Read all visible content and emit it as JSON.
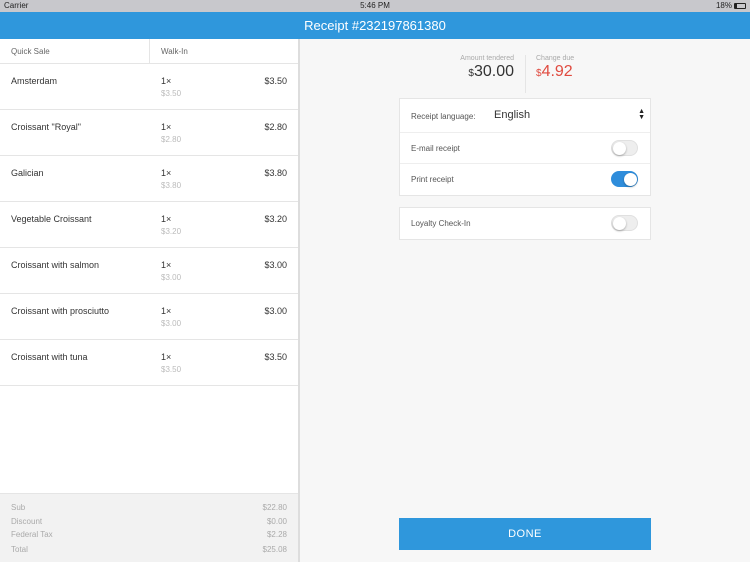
{
  "status": {
    "carrier": "Carrier",
    "time": "5:46 PM",
    "battery": "18%"
  },
  "header": {
    "title": "Receipt #232197861380"
  },
  "order": {
    "col1": "Quick Sale",
    "col2": "Walk-In",
    "items": [
      {
        "name": "Amsterdam",
        "qty": "1×",
        "unit": "$3.50",
        "price": "$3.50"
      },
      {
        "name": "Croissant \"Royal\"",
        "qty": "1×",
        "unit": "$2.80",
        "price": "$2.80"
      },
      {
        "name": "Galician",
        "qty": "1×",
        "unit": "$3.80",
        "price": "$3.80"
      },
      {
        "name": "Vegetable Croissant",
        "qty": "1×",
        "unit": "$3.20",
        "price": "$3.20"
      },
      {
        "name": "Croissant with salmon",
        "qty": "1×",
        "unit": "$3.00",
        "price": "$3.00"
      },
      {
        "name": "Croissant with prosciutto",
        "qty": "1×",
        "unit": "$3.00",
        "price": "$3.00"
      },
      {
        "name": "Croissant with tuna",
        "qty": "1×",
        "unit": "$3.50",
        "price": "$3.50"
      }
    ],
    "totals": [
      {
        "label": "Sub",
        "value": "$22.80"
      },
      {
        "label": "Discount",
        "value": "$0.00"
      },
      {
        "label": "Federal Tax",
        "value": "$2.28"
      },
      {
        "label": "Total",
        "value": "$25.08"
      }
    ]
  },
  "payment": {
    "tendered_label": "Amount tendered",
    "tendered_currency": "$",
    "tendered_value": "30.00",
    "change_label": "Change due",
    "change_currency": "$",
    "change_value": "4.92",
    "change_color": "#e04a3f"
  },
  "options": {
    "language_label": "Receipt language:",
    "language_value": "English",
    "email_label": "E-mail receipt",
    "email_on": false,
    "print_label": "Print receipt",
    "print_on": true,
    "loyalty_label": "Loyalty Check-In",
    "loyalty_on": false
  },
  "done_label": "DONE"
}
